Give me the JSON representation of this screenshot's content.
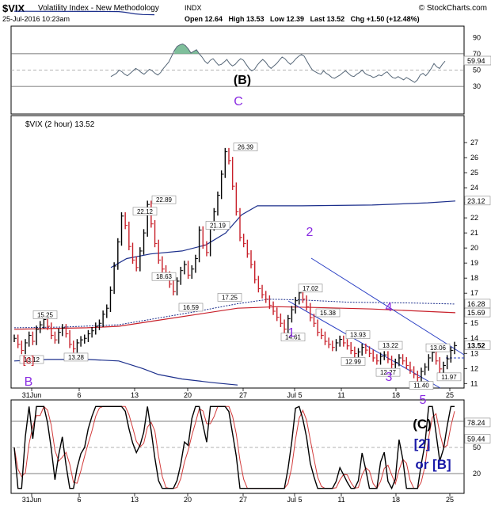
{
  "header": {
    "symbol": "$VIX",
    "name": "Volatility Index - New Methodology",
    "exchange": "INDX",
    "copyright": "© StockCharts.com",
    "timestamp": "25-Jul-2016 10:23am",
    "quote": "Open 12.64   High 13.53   Low 12.39   Last 13.52   Chg +1.50 (+12.48%)"
  },
  "chart_data": [
    {
      "type": "line",
      "name": "RSI",
      "ylim": [
        0,
        100
      ],
      "y_ticks": [
        30,
        50,
        70,
        90
      ],
      "reference_lines": [
        30,
        50,
        70
      ],
      "last_value_label": "59.94",
      "series": [
        {
          "name": "RSI(14)",
          "values": [
            42,
            44,
            46,
            50,
            48,
            45,
            43,
            46,
            49,
            52,
            50,
            47,
            45,
            48,
            51,
            49,
            46,
            44,
            47,
            52,
            56,
            60,
            67,
            74,
            79,
            81,
            82,
            80,
            76,
            71,
            73,
            75,
            70,
            66,
            61,
            58,
            62,
            64,
            60,
            56,
            57,
            60,
            63,
            58,
            55,
            57,
            61,
            64,
            62,
            57,
            52,
            49,
            51,
            56,
            60,
            63,
            60,
            55,
            52,
            55,
            58,
            62,
            66,
            64,
            60,
            57,
            60,
            64,
            67,
            69,
            67,
            61,
            55,
            50,
            48,
            46,
            45,
            49,
            46,
            44,
            41,
            40,
            42,
            44,
            47,
            49,
            46,
            43,
            42,
            45,
            47,
            50,
            46,
            44,
            43,
            41,
            42,
            44,
            43,
            46,
            48,
            44,
            41,
            40,
            42,
            40,
            38,
            41,
            39,
            37,
            35,
            38,
            44,
            46,
            43,
            47,
            52,
            58,
            54,
            52,
            57,
            61
          ]
        }
      ]
    },
    {
      "type": "line",
      "name": "Price",
      "title": "$VIX (2 hour) 13.52",
      "ylim": [
        10.7,
        28
      ],
      "y_ticks": [
        11,
        12,
        13,
        14,
        15,
        16,
        17,
        18,
        19,
        20,
        21,
        22,
        23,
        24,
        25,
        26,
        27
      ],
      "x_ticks": [
        "31Jun",
        "6",
        "13",
        "20",
        "27",
        "Jul 5",
        "11",
        "18",
        "25"
      ],
      "series": [
        {
          "name": "$VIX",
          "values": [
            14.0,
            13.6,
            13.2,
            13.7,
            14.2,
            13.8,
            14.6,
            14.9,
            15.25,
            14.8,
            14.2,
            13.9,
            14.4,
            14.7,
            14.3,
            13.6,
            13.3,
            13.7,
            13.9,
            14.0,
            14.3,
            14.5,
            14.8,
            15.0,
            15.6,
            16.0,
            17.2,
            18.8,
            20.4,
            22.12,
            21.5,
            20.1,
            19.2,
            18.7,
            19.8,
            21.0,
            22.89,
            21.6,
            20.3,
            19.2,
            18.6,
            18.2,
            17.6,
            17.1,
            17.8,
            18.5,
            18.9,
            18.2,
            18.6,
            19.3,
            21.19,
            20.2,
            19.7,
            21.4,
            22.4,
            23.5,
            24.9,
            26.39,
            25.8,
            24.1,
            22.4,
            20.7,
            20.3,
            19.6,
            18.9,
            17.9,
            17.3,
            16.9,
            16.6,
            16.2,
            15.8,
            15.4,
            15.0,
            14.61,
            15.3,
            15.9,
            16.5,
            17.02,
            16.6,
            16.1,
            15.38,
            15.0,
            14.4,
            14.2,
            13.8,
            13.6,
            13.4,
            13.7,
            13.93,
            13.7,
            13.5,
            13.2,
            12.99,
            13.1,
            13.4,
            13.22,
            13.0,
            12.7,
            12.5,
            12.8,
            12.9,
            12.6,
            12.27,
            12.4,
            12.7,
            12.5,
            12.2,
            11.9,
            11.6,
            11.4,
            11.8,
            12.1,
            12.7,
            13.06,
            12.5,
            11.97,
            12.2,
            12.64,
            13.2,
            13.52
          ]
        }
      ],
      "annotations": [
        {
          "text": "15.25",
          "type": "price_label"
        },
        {
          "text": "13.12",
          "type": "price_label"
        },
        {
          "text": "13.28",
          "type": "price_label"
        },
        {
          "text": "22.12",
          "type": "price_label"
        },
        {
          "text": "22.89",
          "type": "price_label"
        },
        {
          "text": "18.63",
          "type": "price_label"
        },
        {
          "text": "16.59",
          "type": "price_label"
        },
        {
          "text": "21.19",
          "type": "price_label"
        },
        {
          "text": "17.25",
          "type": "price_label"
        },
        {
          "text": "26.39",
          "type": "price_label"
        },
        {
          "text": "17.02",
          "type": "price_label"
        },
        {
          "text": "15.38",
          "type": "price_label"
        },
        {
          "text": "14.61",
          "type": "price_label"
        },
        {
          "text": "13.93",
          "type": "price_label"
        },
        {
          "text": "12.99",
          "type": "price_label"
        },
        {
          "text": "13.22",
          "type": "price_label"
        },
        {
          "text": "12.27",
          "type": "price_label"
        },
        {
          "text": "11.40",
          "type": "price_label"
        },
        {
          "text": "13.06",
          "type": "price_label"
        },
        {
          "text": "11.97",
          "type": "price_label"
        }
      ],
      "wave_labels": [
        "(B)",
        "C",
        "[c]",
        "B",
        "2",
        "1",
        "4",
        "3",
        "5"
      ],
      "right_labels": [
        "23.12",
        "16.28",
        "15.69",
        "13.52"
      ]
    },
    {
      "type": "line",
      "name": "Stochastics",
      "ylim": [
        0,
        100
      ],
      "y_ticks": [
        20,
        50,
        80
      ],
      "reference_lines": [
        20,
        50,
        80
      ],
      "last_value_labels": [
        "78.24",
        "59.44"
      ],
      "wave_labels": [
        "(C)",
        "[2]",
        "or [B]"
      ]
    }
  ]
}
